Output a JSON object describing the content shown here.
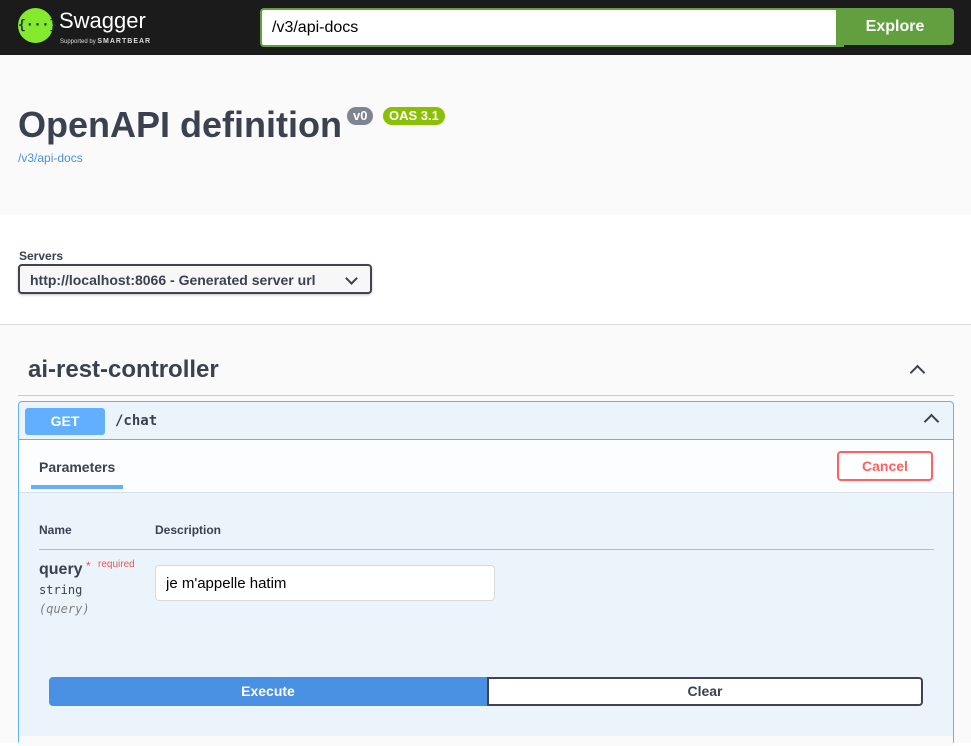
{
  "topbar": {
    "logo_glyph": "{···}",
    "brand": "Swagger",
    "tagline_prefix": "Supported by",
    "tagline_brand": "SMARTBEAR",
    "url_value": "/v3/api-docs",
    "explore_label": "Explore"
  },
  "info": {
    "title": "OpenAPI definition",
    "version_badge": "v0",
    "oas_badge": "OAS 3.1",
    "spec_link": "/v3/api-docs"
  },
  "servers": {
    "label": "Servers",
    "selected": "http://localhost:8066 - Generated server url"
  },
  "tag": {
    "name": "ai-rest-controller"
  },
  "operation": {
    "method": "GET",
    "path": "/chat",
    "tab_label": "Parameters",
    "cancel_label": "Cancel",
    "col_name": "Name",
    "col_description": "Description",
    "param": {
      "name": "query",
      "required_star": "*",
      "required_label": "required",
      "type": "string",
      "location": "(query)",
      "value": "je m'appelle hatim"
    },
    "execute_label": "Execute",
    "clear_label": "Clear"
  },
  "colors": {
    "topbar_bg": "#1b1b1b",
    "explore_green": "#62a03f",
    "get_blue": "#61affe",
    "execute_blue": "#4990e2",
    "cancel_red": "#ff6060",
    "oas_green": "#89bf04"
  }
}
